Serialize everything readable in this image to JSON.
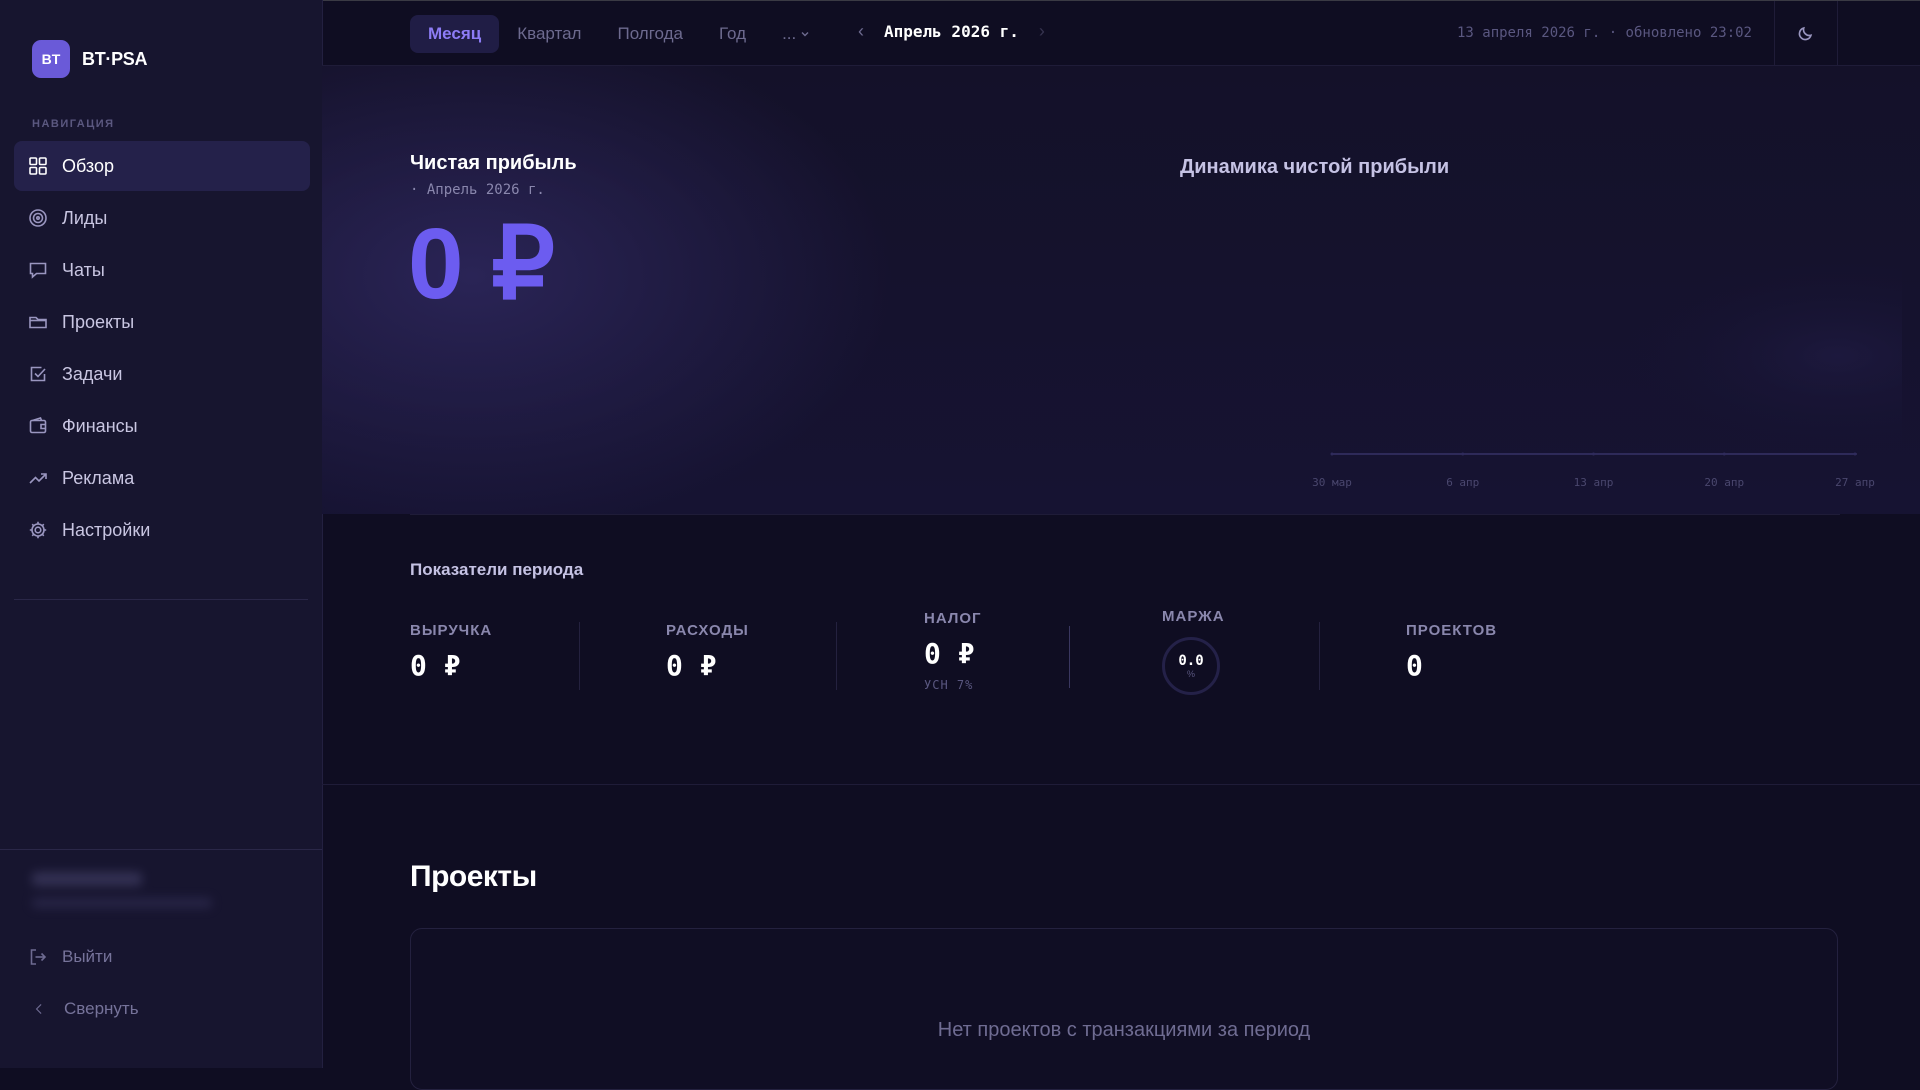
{
  "app": {
    "logo_badge": "BT",
    "logo_text": "BT·PSA"
  },
  "sidebar": {
    "caption": "НАВИГАЦИЯ",
    "items": [
      {
        "label": "Обзор",
        "icon": "grid-icon",
        "active": true
      },
      {
        "label": "Лиды",
        "icon": "target-icon"
      },
      {
        "label": "Чаты",
        "icon": "chat-icon"
      },
      {
        "label": "Проекты",
        "icon": "folder-icon"
      },
      {
        "label": "Задачи",
        "icon": "checkbox-icon"
      },
      {
        "label": "Финансы",
        "icon": "wallet-icon"
      },
      {
        "label": "Реклама",
        "icon": "trend-up-icon"
      },
      {
        "label": "Настройки",
        "icon": "gear-icon"
      }
    ],
    "logout_label": "Выйти",
    "collapse_label": "Свернуть"
  },
  "topbar": {
    "tabs": [
      "Месяц",
      "Квартал",
      "Полгода",
      "Год"
    ],
    "active_tab": "Месяц",
    "more_label": "...",
    "period_label": "Апрель 2026 г.",
    "updated_text": "13 апреля 2026 г. · обновлено 23:02"
  },
  "hero": {
    "title": "Чистая прибыль",
    "subtitle": "· Апрель 2026 г.",
    "value": "0 ₽"
  },
  "chart_data": {
    "type": "area",
    "title": "Динамика чистой прибыли",
    "x": [
      "30 мар",
      "6 апр",
      "13 апр",
      "20 апр",
      "27 апр"
    ],
    "series": [
      {
        "values": [
          0,
          0,
          0,
          0,
          0
        ]
      }
    ],
    "grid": false,
    "legend": "none"
  },
  "kpis": {
    "section_title": "Показатели периода",
    "revenue": {
      "label": "ВЫРУЧКА",
      "value": "0 ₽"
    },
    "expenses": {
      "label": "РАСХОДЫ",
      "value": "0 ₽"
    },
    "tax": {
      "label": "НАЛОГ",
      "value": "0 ₽",
      "note": "УСН 7%"
    },
    "margin": {
      "label": "МАРЖА",
      "value": "0.0",
      "unit": "%"
    },
    "projects": {
      "label": "ПРОЕКТОВ",
      "value": "0"
    }
  },
  "projects": {
    "title": "Проекты",
    "empty_text": "Нет проектов с транзакциями за период"
  },
  "colors": {
    "accent": "#6c5cf0",
    "background": "#0f0d22",
    "sidebar": "#17152f"
  }
}
